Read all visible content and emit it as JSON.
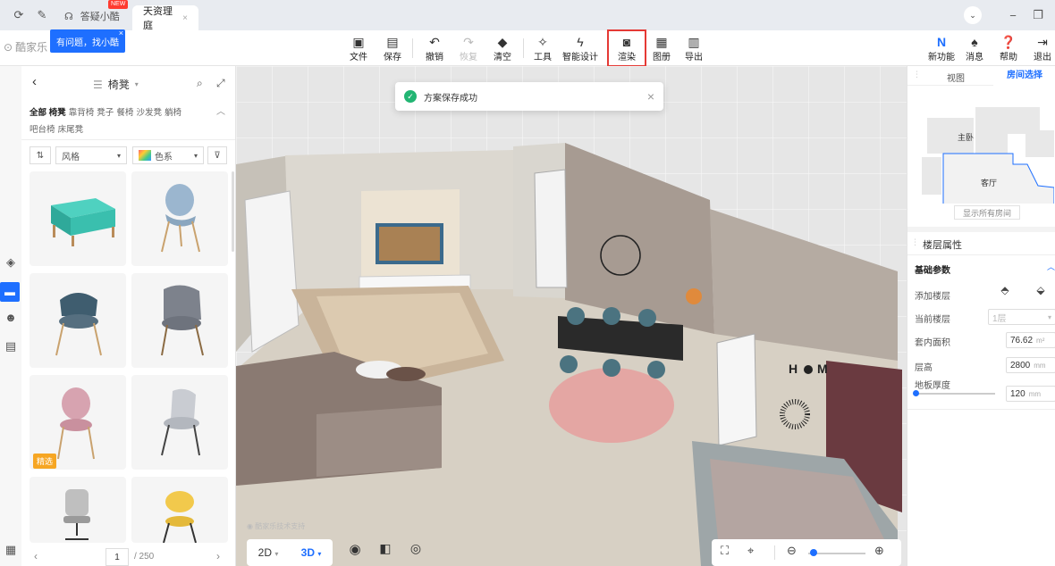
{
  "titlebar": {
    "tab_inactive": "答疑小酷",
    "tab_inactive_badge": "NEW",
    "tab_active": "天资理庭",
    "help_popup": "有问题，找小酷",
    "logo_text": "酷家乐"
  },
  "toolbar": {
    "file": "文件",
    "save": "保存",
    "undo": "撤销",
    "redo": "恢复",
    "clear": "清空",
    "tools": "工具",
    "smart_design": "智能设计",
    "render": "渲染",
    "album": "图册",
    "export": "导出",
    "new_feature": "新功能",
    "messages": "消息",
    "help": "帮助",
    "exit": "退出"
  },
  "panel": {
    "title": "椅凳",
    "categories": [
      "全部 椅凳",
      "靠背椅",
      "凳子",
      "餐椅",
      "沙发凳",
      "躺椅",
      "吧台椅",
      "床尾凳"
    ],
    "filter_style": "风格",
    "filter_color": "色系",
    "selected_badge": "精选",
    "page_current": "1",
    "page_total": "/ 250"
  },
  "toast": {
    "message": "方案保存成功"
  },
  "viewport": {
    "view_2d": "2D",
    "view_3d": "3D",
    "watermark": "酷家乐技术支持"
  },
  "right_panel": {
    "tab_view": "视图",
    "tab_room": "房间选择",
    "room_master": "主卧",
    "room_living": "客厅",
    "show_all_rooms": "显示所有房间",
    "floor_props": "楼层属性",
    "basic_params": "基础参数",
    "add_floor": "添加楼层",
    "current_floor": "当前楼层",
    "current_floor_value": "1层",
    "inner_area": "套内面积",
    "inner_area_value": "76.62",
    "inner_area_unit": "m²",
    "floor_height": "层高",
    "floor_height_value": "2800",
    "floor_height_unit": "mm",
    "floor_thickness": "地板厚度",
    "floor_thickness_value": "120",
    "floor_thickness_unit": "mm"
  },
  "colors": {
    "accent": "#1e6fff",
    "render_highlight": "#e53935",
    "success": "#22b573"
  }
}
